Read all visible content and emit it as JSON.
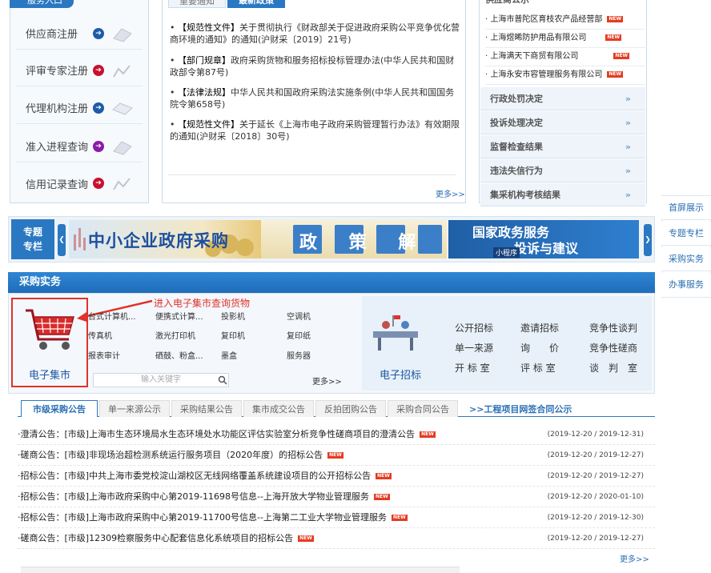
{
  "registration": {
    "header": "服务入口",
    "items": [
      {
        "label": "供应商注册",
        "icon_color": "#1e5aa8"
      },
      {
        "label": "评审专家注册",
        "icon_color": "#c8102e"
      },
      {
        "label": "代理机构注册",
        "icon_color": "#1e5aa8"
      },
      {
        "label": "准入进程查询",
        "icon_color": "#8b1ba8"
      },
      {
        "label": "信用记录查询",
        "icon_color": "#c8102e"
      }
    ]
  },
  "notices": {
    "tabs": [
      "重要通知",
      "最新政策"
    ],
    "items": [
      {
        "tag": "【规范性文件】",
        "text": "关于贯彻执行《财政部关于促进政府采购公平竞争优化营商环境的通知》的通知(沪财采〔2019〕21号)"
      },
      {
        "tag": "【部门规章】",
        "text": "政府采购货物和服务招标投标管理办法(中华人民共和国财政部令第87号)"
      },
      {
        "tag": "【法律法规】",
        "text": "中华人民共和国政府采购法实施条例(中华人民共和国国务院令第658号)"
      },
      {
        "tag": "【规范性文件】",
        "text": "关于延长《上海市电子政府采购管理暂行办法》有效期限的通知(沪财采〔2018〕30号)"
      }
    ],
    "more": "更多>>"
  },
  "suppliers": {
    "header": "供应商公示",
    "items": [
      {
        "name": "上海市普陀区育枝农产品经营部",
        "badge": "NEW"
      },
      {
        "name": "上海煜晞防护用品有限公司",
        "badge": "NEW"
      },
      {
        "name": "上海满天下商贸有限公司",
        "badge": "NEW"
      },
      {
        "name": "上海永安市容管理服务有限公司",
        "badge": "NEW"
      }
    ]
  },
  "right_menu": [
    {
      "label": "行政处罚决定",
      "chevron": "»"
    },
    {
      "label": "投诉处理决定",
      "chevron": "»"
    },
    {
      "label": "监督检查结果",
      "chevron": "»"
    },
    {
      "label": "违法失信行为",
      "chevron": "»"
    },
    {
      "label": "集采机构考核结果",
      "chevron": "»"
    }
  ],
  "side_nav": [
    "首屏展示",
    "专题专栏",
    "采购实务",
    "办事服务"
  ],
  "banner": {
    "topic_line1": "专题",
    "topic_line2": "专栏",
    "b1": "中小企业政府采购",
    "b2": "政 策 解 读",
    "b3_line1": "国家政务服务",
    "b3_line2": "投诉与建议",
    "b3_tag": "小程序",
    "arrow_left": "❮",
    "arrow_right": "❯"
  },
  "purchase": {
    "title": "采购实务",
    "annotation": "进入电子集市查询货物",
    "emall_label": "电子集市",
    "categories": [
      [
        "台式计算机...",
        "便携式计算...",
        "投影机",
        "空调机"
      ],
      [
        "传真机",
        "激光打印机",
        "复印机",
        "复印纸"
      ],
      [
        "报表审计",
        "硒鼓、粉盒...",
        "墨盒",
        "服务器"
      ]
    ],
    "search_placeholder": "输入关键字",
    "more": "更多>>",
    "etender_label": "电子招标",
    "tender_links": [
      [
        "公开招标",
        "邀请招标",
        "竞争性谈判"
      ],
      [
        "单一来源",
        "询　　价",
        "竞争性磋商"
      ],
      [
        "开 标 室",
        "评 标 室",
        "谈　判　室"
      ]
    ]
  },
  "tabs": {
    "items": [
      "市级采购公告",
      "单一来源公示",
      "采购结果公告",
      "集市成交公告",
      "反拍团购公告",
      "采购合同公告"
    ],
    "extra": ">>工程项目网签合同公示",
    "rows": [
      {
        "text": "·澄清公告：[市级]上海市生态环境局水生态环境处水功能区评估实验室分析竞争性磋商项目的澄清公告",
        "date": "(2019-12-20 / 2019-12-31)"
      },
      {
        "text": "·磋商公告：[市级]非现场治超检测系统运行服务项目（2020年度）的招标公告",
        "date": "(2019-12-20 / 2019-12-27)"
      },
      {
        "text": "·招标公告：[市级]中共上海市委党校淀山湖校区无线网络覆盖系统建设项目的公开招标公告",
        "date": "(2019-12-20 / 2019-12-27)"
      },
      {
        "text": "·招标公告：[市级]上海市政府采购中心第2019-11698号信息--上海开放大学物业管理服务",
        "date": "(2019-12-20 / 2020-01-10)"
      },
      {
        "text": "·招标公告：[市级]上海市政府采购中心第2019-11700号信息--上海第二工业大学物业管理服务",
        "date": "(2019-12-20 / 2019-12-30)"
      },
      {
        "text": "·磋商公告：[市级]12309检察服务中心配套信息化系统项目的招标公告",
        "date": "(2019-12-20 / 2019-12-27)"
      }
    ],
    "more": "更多>>"
  },
  "colors": {
    "accent": "#2a78c2",
    "badge": "#e53b21",
    "annotation": "#e53b21"
  }
}
